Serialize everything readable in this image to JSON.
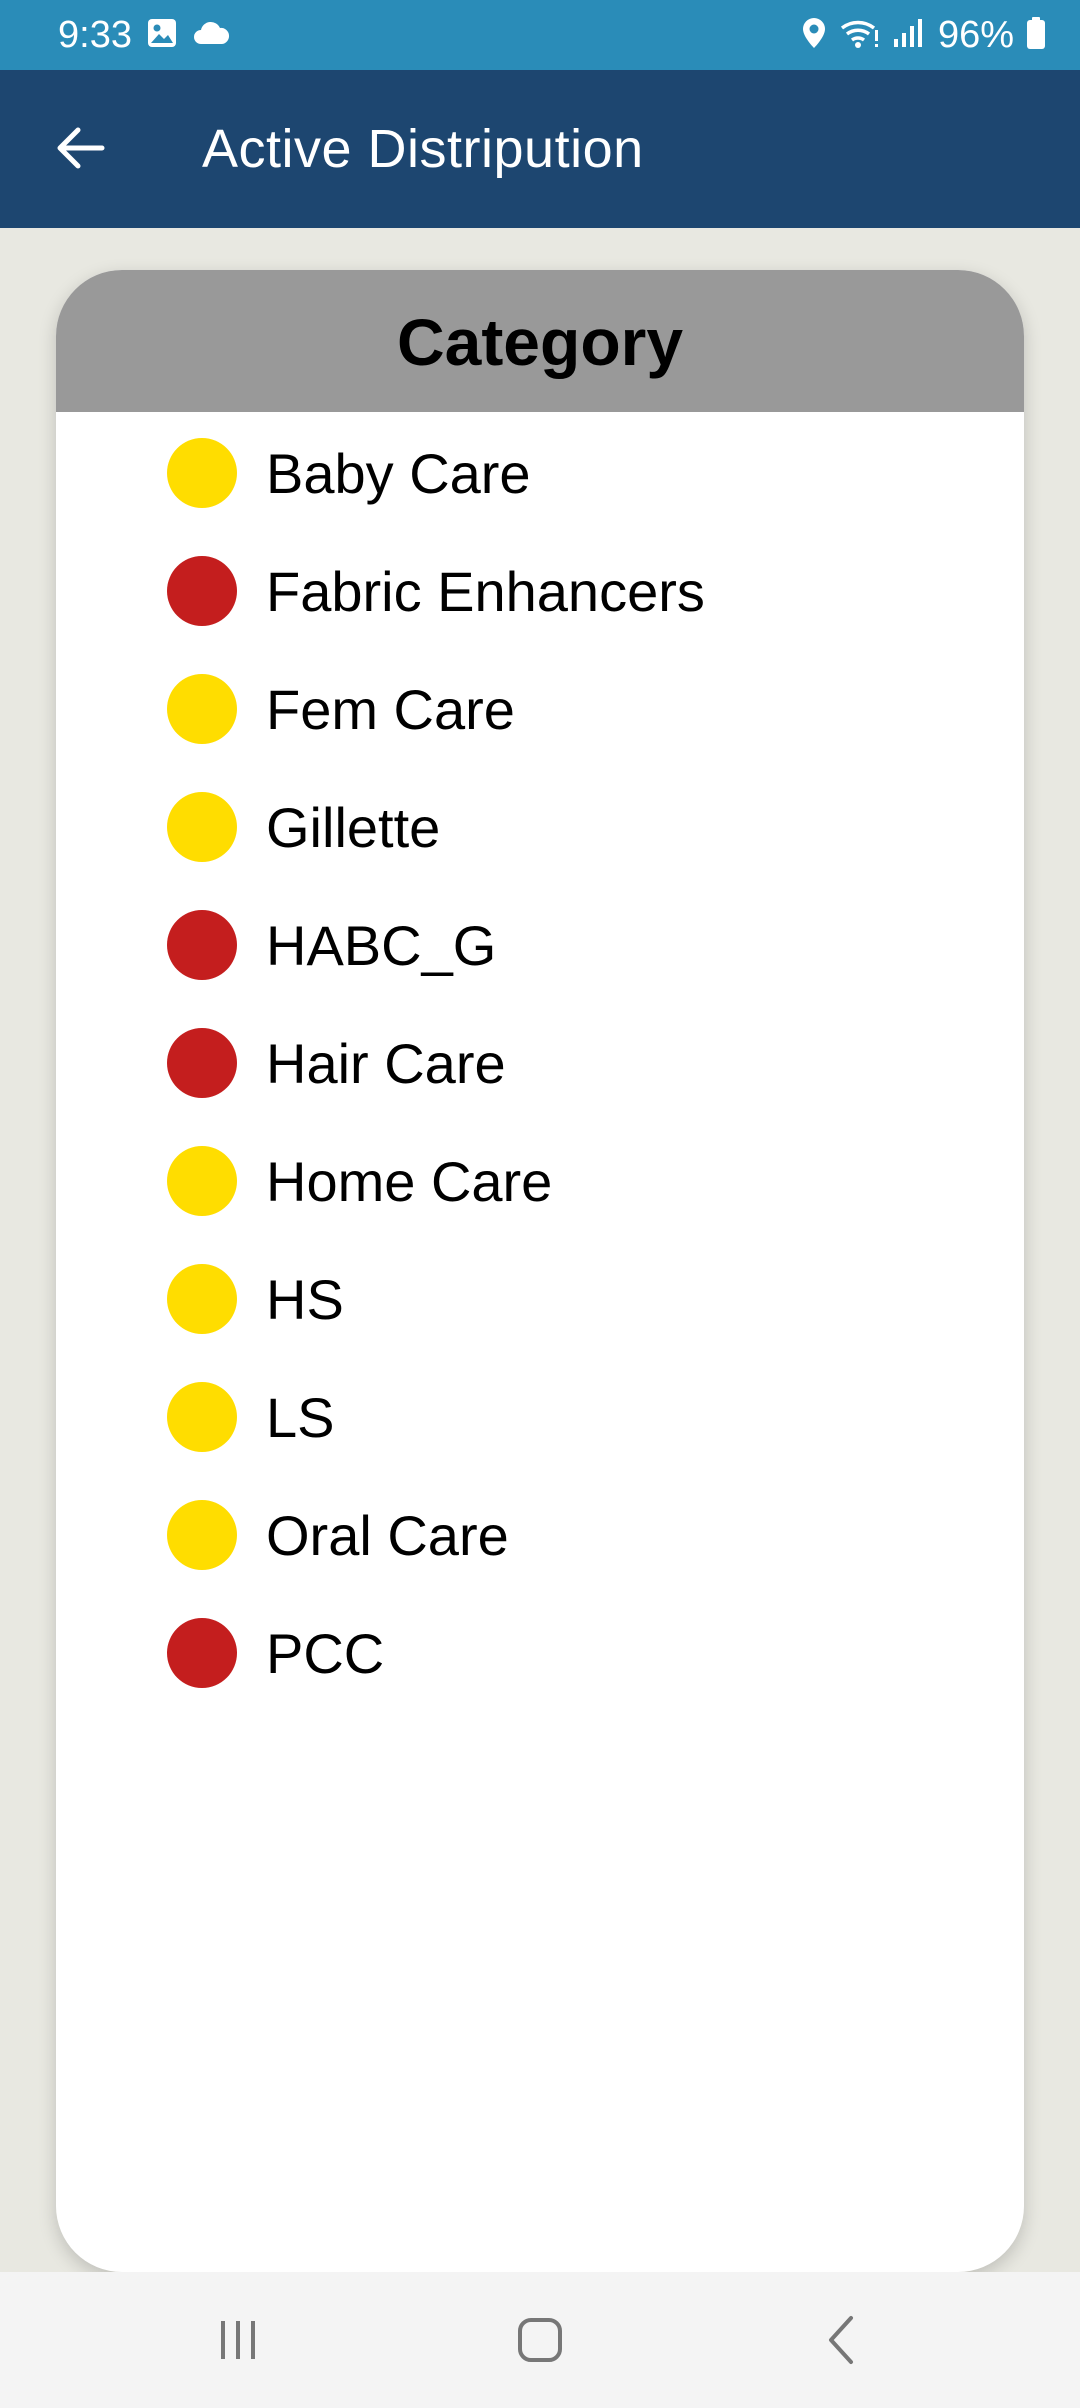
{
  "status_bar": {
    "time": "9:33",
    "left_icons": [
      "image-icon",
      "cloud-icon"
    ],
    "right_icons": [
      "location-icon",
      "wifi-icon",
      "signal-icon",
      "battery-icon"
    ],
    "battery": "96%"
  },
  "app_bar": {
    "back_icon": "arrow-left-icon",
    "title": "Active Distripution"
  },
  "card": {
    "header": "Category",
    "items": [
      {
        "label": "Baby Care",
        "status": "yellow"
      },
      {
        "label": "Fabric Enhancers",
        "status": "red"
      },
      {
        "label": "Fem Care",
        "status": "yellow"
      },
      {
        "label": "Gillette",
        "status": "yellow"
      },
      {
        "label": "HABC_G",
        "status": "red"
      },
      {
        "label": "Hair Care",
        "status": "red"
      },
      {
        "label": "Home Care",
        "status": "yellow"
      },
      {
        "label": "HS",
        "status": "yellow"
      },
      {
        "label": "LS",
        "status": "yellow"
      },
      {
        "label": "Oral Care",
        "status": "yellow"
      },
      {
        "label": "PCC",
        "status": "red"
      }
    ]
  },
  "colors": {
    "status_bar": "#2a8cb8",
    "app_bar": "#1d4670",
    "header": "#999999",
    "yellow": "#ffdd00",
    "red": "#c41e1e",
    "background": "#e8e8e1"
  },
  "nav_bar": {
    "icons": [
      "recent-apps-icon",
      "home-icon",
      "back-icon"
    ]
  }
}
